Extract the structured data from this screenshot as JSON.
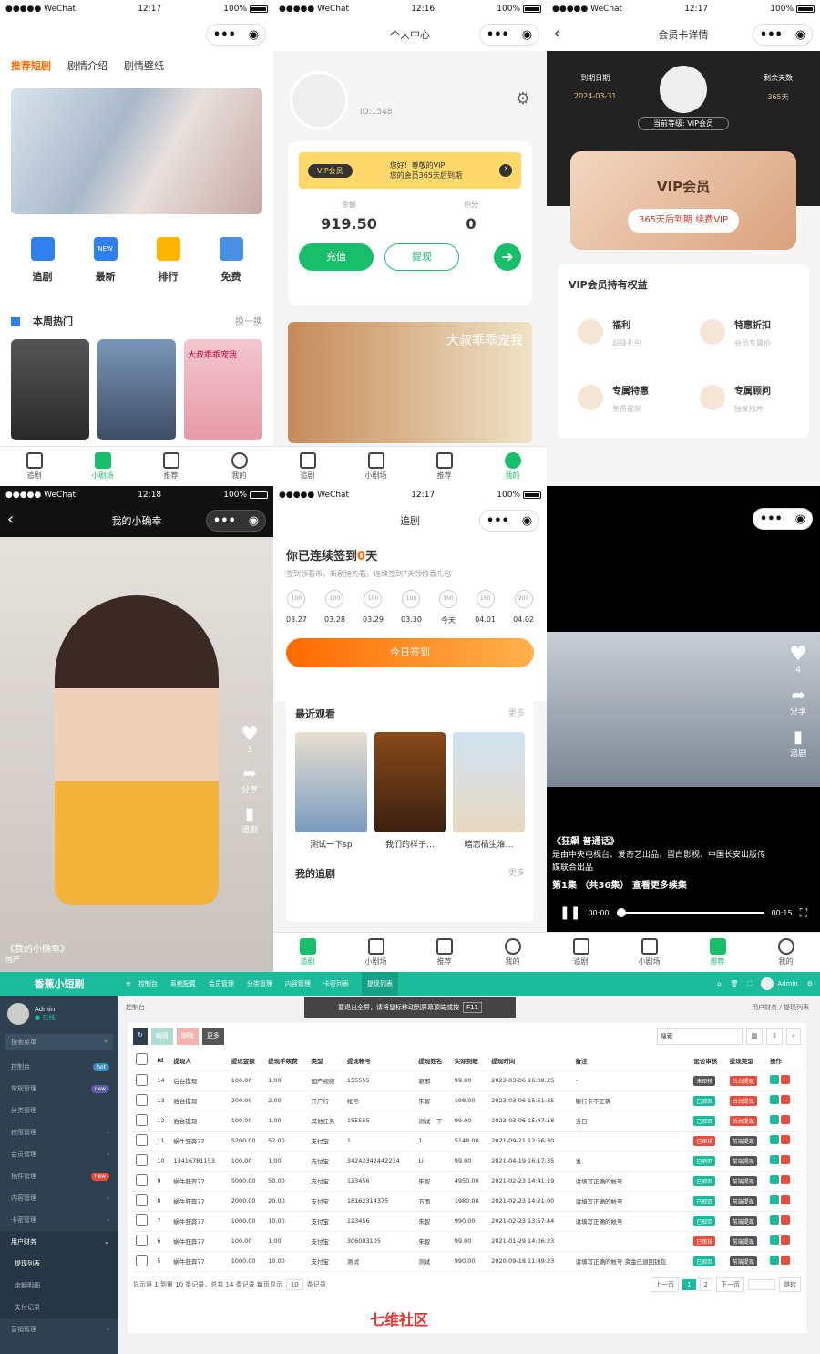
{
  "status": {
    "carrier": "●●●●● WeChat",
    "battery": "100%",
    "times": [
      "12:17",
      "12:16",
      "12:17",
      "12:18",
      "12:17"
    ]
  },
  "p1": {
    "tabs": [
      "推荐短剧",
      "剧情介绍",
      "剧情壁纸"
    ],
    "quick": [
      "追剧",
      "最新",
      "排行",
      "免费"
    ],
    "new_badge": "NEW",
    "hot_title": "本周热门",
    "refresh": "换一换",
    "poster_text": "大叔乖乖宠我"
  },
  "tabbar": [
    "追剧",
    "小剧场",
    "推荐",
    "我的"
  ],
  "p2": {
    "title": "个人中心",
    "uid": "ID:1548",
    "vip_tag": "VIP会员",
    "vip_msg1": "您好！尊敬的VIP",
    "vip_msg2": "您的会员365天后到期",
    "balance_label": "余额",
    "balance": "919.50",
    "points_label": "积分",
    "points": "0",
    "recharge": "充值",
    "withdraw": "提现",
    "banner_text": "大叔乖乖宠我"
  },
  "p3": {
    "title": "会员卡详情",
    "expire_label": "到期日期",
    "expire_date": "2024-03-31",
    "days_label": "剩余天数",
    "days": "365天",
    "level": "当前等级: VIP会员",
    "card_title": "VIP会员",
    "card_sub": "365天后到期 续费VIP",
    "rights_title": "VIP会员持有权益",
    "rights": [
      {
        "t": "福利",
        "s": "超级礼包"
      },
      {
        "t": "特惠折扣",
        "s": "会员专属价"
      },
      {
        "t": "专属特惠",
        "s": "免费视频"
      },
      {
        "t": "专属顾问",
        "s": "独家找片"
      }
    ]
  },
  "p4": {
    "title": "我的小确幸",
    "like": "3",
    "share": "分享",
    "follow": "追剧",
    "caption": "《我的小确幸》",
    "caption2": "国产"
  },
  "p5": {
    "title": "追剧",
    "checkin_pre": "你已连续签到",
    "checkin_num": "0",
    "checkin_suf": "天",
    "desc": "签到领看币，新剧抢先看。连续签到7天领惊喜礼包",
    "coins": [
      "100",
      "100",
      "100",
      "100",
      "100",
      "150",
      "200"
    ],
    "dates": [
      "03.27",
      "03.28",
      "03.29",
      "03.30",
      "今天",
      "04.01",
      "04.02"
    ],
    "btn": "今日签到",
    "recent": "最近观看",
    "more": "更多",
    "items": [
      "测试一下sp",
      "我们的样子…",
      "暗恋橘生淮…"
    ],
    "my": "我的追剧",
    "more2": "更多"
  },
  "p6": {
    "like": "4",
    "share": "分享",
    "follow": "追剧",
    "title": "《狂飙 普通话》",
    "desc": "是由中央电视台、爱奇艺出品，留白影视、中国长安出版传媒联合出品",
    "ep": "第1集 （共36集） 查看更多续集",
    "t0": "00:00",
    "t1": "00:15"
  },
  "admin": {
    "brand": "香蕉小短剧",
    "top_menu": [
      "控制台",
      "系统配置",
      "会员管理",
      "分类管理",
      "内容管理",
      "卡密列表",
      "提现列表"
    ],
    "user": "Admin",
    "user_side": "Admin",
    "online": "● 在线",
    "search": "搜索菜单",
    "breadcrumb": "控制台",
    "crumb_r": "用户财务 / 提现列表",
    "fullscreen": "要退出全屏，请将鼠标移动到屏幕顶端或按",
    "f11": "F11",
    "btns": [
      "编辑",
      "删除",
      "更多"
    ],
    "search2": "搜索",
    "side_menu": [
      {
        "l": "控制台",
        "b": "hot"
      },
      {
        "l": "常规管理",
        "b": "new"
      },
      {
        "l": "分类管理",
        "b": ""
      },
      {
        "l": "权限管理",
        "b": ""
      },
      {
        "l": "会员管理",
        "b": ""
      },
      {
        "l": "插件管理",
        "b": "new"
      },
      {
        "l": "内容管理",
        "b": ""
      },
      {
        "l": "卡密管理",
        "b": ""
      },
      {
        "l": "用户财务",
        "b": ""
      },
      {
        "l": "提现列表",
        "b": ""
      },
      {
        "l": "余额明细",
        "b": ""
      },
      {
        "l": "支付记录",
        "b": ""
      },
      {
        "l": "营销管理",
        "b": ""
      }
    ],
    "cols": [
      "Id",
      "提现人",
      "提现金额",
      "提现手续费",
      "类型",
      "提现帐号",
      "提现姓名",
      "实际到账",
      "提现时间",
      "备注",
      "是否审核",
      "提现类型",
      "操作"
    ],
    "rows": [
      [
        "14",
        "后台提现",
        "100.00",
        "1.00",
        "国产视频",
        "155555",
        "驱邪",
        "99.00",
        "2023-03-06 16:08:25",
        "-",
        "未审核",
        "后台提现"
      ],
      [
        "13",
        "后台提现",
        "200.00",
        "2.00",
        "开户行",
        "帐号",
        "朱智",
        "198.00",
        "2023-03-06 15:51:35",
        "银行卡不正确",
        "已驳回",
        "后台提现"
      ],
      [
        "12",
        "后台提现",
        "100.00",
        "1.00",
        "其他任务",
        "155555",
        "测试一下",
        "99.00",
        "2023-03-06 15:47:18",
        "当日",
        "已驳回",
        "后台提现"
      ],
      [
        "11",
        "蜗牛狂奔77",
        "5200.00",
        "52.00",
        "支付宝",
        "1",
        "1",
        "5148.00",
        "2021-09-21 12:56:30",
        "",
        "已审核",
        "前端提现"
      ],
      [
        "10",
        "13416781153",
        "100.00",
        "1.00",
        "支付宝",
        "34242342442234",
        "Li",
        "99.00",
        "2021-04-19 16:17:35",
        "发",
        "已驳回",
        "前端提现"
      ],
      [
        "9",
        "蜗牛狂奔77",
        "5000.00",
        "50.00",
        "支付宝",
        "123456",
        "朱智",
        "4950.00",
        "2021-02-23 14:41:19",
        "请填写正确的帐号",
        "已驳回",
        "前端提现"
      ],
      [
        "8",
        "蜗牛狂奔77",
        "2000.00",
        "20.00",
        "支付宝",
        "18162314375",
        "方面",
        "1980.00",
        "2021-02-23 14:21:00",
        "请填写正确的帐号",
        "已驳回",
        "前端提现"
      ],
      [
        "7",
        "蜗牛狂奔77",
        "1000.00",
        "10.00",
        "支付宝",
        "123456",
        "朱智",
        "990.00",
        "2021-02-23 13:57:44",
        "请填写正确的帐号",
        "已驳回",
        "前端提现"
      ],
      [
        "6",
        "蜗牛狂奔77",
        "100.00",
        "1.00",
        "支付宝",
        "306003105",
        "朱智",
        "99.00",
        "2021-01-29 14:06:23",
        "",
        "已审核",
        "前端提现"
      ],
      [
        "5",
        "蜗牛狂奔77",
        "1000.00",
        "10.00",
        "支付宝",
        "测试",
        "测试",
        "990.00",
        "2020-09-18 11:49:23",
        "请填写正确的帐号 资金已退回钱包",
        "已驳回",
        "前端提现"
      ]
    ],
    "footer": "显示第 1 到第 10 条记录，总共 14 条记录 每页显示",
    "pagesize": "10",
    "footer2": "条记录",
    "pager": [
      "上一页",
      "1",
      "2",
      "下一页"
    ],
    "jump": "跳转"
  },
  "watermark": "七维社区"
}
